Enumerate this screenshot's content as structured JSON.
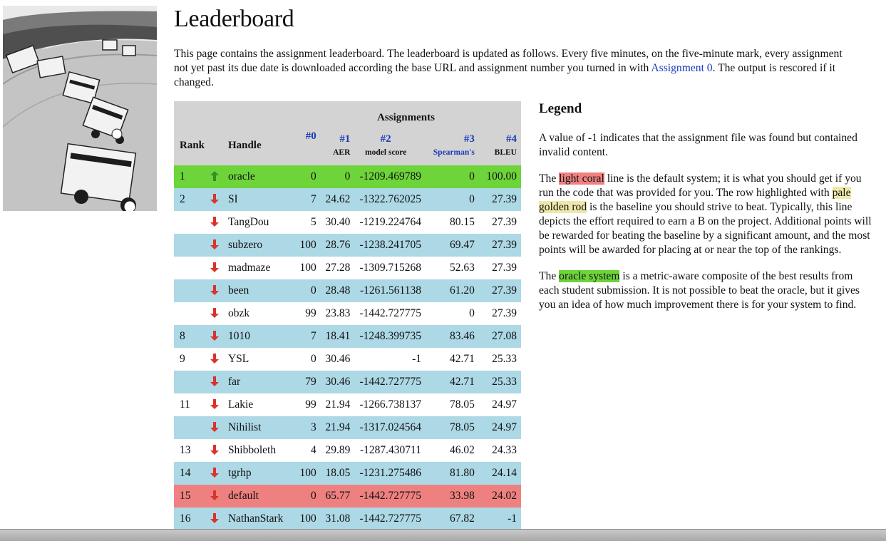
{
  "page": {
    "title": "Leaderboard",
    "intro_before_link": "This page contains the assignment leaderboard. The leaderboard is updated as follows. Every five minutes, on the five-minute mark, every assignment not yet past its due date is downloaded according the base URL and assignment number you turned in with ",
    "intro_link": "Assignment 0",
    "intro_after_link": ". The output is rescored if it changed."
  },
  "table": {
    "group_header": "Assignments",
    "rank_header": "Rank",
    "handle_header": "Handle",
    "assignments": [
      {
        "num": "#0",
        "sub": ""
      },
      {
        "num": "#1",
        "sub": "AER"
      },
      {
        "num": "#2",
        "sub": "model score"
      },
      {
        "num": "#3",
        "sub": "Spearman's"
      },
      {
        "num": "#4",
        "sub": "BLEU"
      }
    ],
    "rows": [
      {
        "rank": "1",
        "arrow": "up",
        "handle": "oracle",
        "a0": "0",
        "a1": "0",
        "a2": "-1209.469789",
        "a3": "0",
        "a4": "100.00",
        "style": "oracle"
      },
      {
        "rank": "2",
        "arrow": "down",
        "handle": "SI",
        "a0": "7",
        "a1": "24.62",
        "a2": "-1322.762025",
        "a3": "0",
        "a4": "27.39",
        "style": "even"
      },
      {
        "rank": "",
        "arrow": "down",
        "handle": "TangDou",
        "a0": "5",
        "a1": "30.40",
        "a2": "-1219.224764",
        "a3": "80.15",
        "a4": "27.39",
        "style": "odd"
      },
      {
        "rank": "",
        "arrow": "down",
        "handle": "subzero",
        "a0": "100",
        "a1": "28.76",
        "a2": "-1238.241705",
        "a3": "69.47",
        "a4": "27.39",
        "style": "even"
      },
      {
        "rank": "",
        "arrow": "down",
        "handle": "madmaze",
        "a0": "100",
        "a1": "27.28",
        "a2": "-1309.715268",
        "a3": "52.63",
        "a4": "27.39",
        "style": "odd"
      },
      {
        "rank": "",
        "arrow": "down",
        "handle": "been",
        "a0": "0",
        "a1": "28.48",
        "a2": "-1261.561138",
        "a3": "61.20",
        "a4": "27.39",
        "style": "even"
      },
      {
        "rank": "",
        "arrow": "down",
        "handle": "obzk",
        "a0": "99",
        "a1": "23.83",
        "a2": "-1442.727775",
        "a3": "0",
        "a4": "27.39",
        "style": "odd"
      },
      {
        "rank": "8",
        "arrow": "down",
        "handle": "1010",
        "a0": "7",
        "a1": "18.41",
        "a2": "-1248.399735",
        "a3": "83.46",
        "a4": "27.08",
        "style": "even"
      },
      {
        "rank": "9",
        "arrow": "down",
        "handle": "YSL",
        "a0": "0",
        "a1": "30.46",
        "a2": "-1",
        "a3": "42.71",
        "a4": "25.33",
        "style": "odd"
      },
      {
        "rank": "",
        "arrow": "down",
        "handle": "far",
        "a0": "79",
        "a1": "30.46",
        "a2": "-1442.727775",
        "a3": "42.71",
        "a4": "25.33",
        "style": "even"
      },
      {
        "rank": "11",
        "arrow": "down",
        "handle": "Lakie",
        "a0": "99",
        "a1": "21.94",
        "a2": "-1266.738137",
        "a3": "78.05",
        "a4": "24.97",
        "style": "odd"
      },
      {
        "rank": "",
        "arrow": "down",
        "handle": "Nihilist",
        "a0": "3",
        "a1": "21.94",
        "a2": "-1317.024564",
        "a3": "78.05",
        "a4": "24.97",
        "style": "even"
      },
      {
        "rank": "13",
        "arrow": "down",
        "handle": "Shibboleth",
        "a0": "4",
        "a1": "29.89",
        "a2": "-1287.430711",
        "a3": "46.02",
        "a4": "24.33",
        "style": "odd"
      },
      {
        "rank": "14",
        "arrow": "down",
        "handle": "tgrhp",
        "a0": "100",
        "a1": "18.05",
        "a2": "-1231.275486",
        "a3": "81.80",
        "a4": "24.14",
        "style": "even"
      },
      {
        "rank": "15",
        "arrow": "down",
        "handle": "default",
        "a0": "0",
        "a1": "65.77",
        "a2": "-1442.727775",
        "a3": "33.98",
        "a4": "24.02",
        "style": "baseline"
      },
      {
        "rank": "16",
        "arrow": "down",
        "handle": "NathanStark",
        "a0": "100",
        "a1": "31.08",
        "a2": "-1442.727775",
        "a3": "67.82",
        "a4": "-1",
        "style": "even"
      }
    ]
  },
  "legend": {
    "title": "Legend",
    "p1": "A value of -1 indicates that the assignment file was found but contained invalid content.",
    "p2_a": "The ",
    "p2_hl1": "light coral",
    "p2_b": " line is the default system; it is what you should get if you run the code that was provided for you. The row highlighted with ",
    "p2_hl2": "pale golden rod",
    "p2_c": " is the baseline you should strive to beat. Typically, this line depicts the effort required to earn a B on the project. Additional points will be rewarded for beating the baseline by a significant amount, and the most points will be awarded for placing at or near the top of the rankings.",
    "p3_a": "The ",
    "p3_hl": "oracle system",
    "p3_b": " is a metric-aware composite of the best results from each student submission. It is not possible to beat the oracle, but it gives you an idea of how much improvement there is for your system to find."
  },
  "colors": {
    "oracle_row": "#6dd43a",
    "baseline_row": "#ef8080",
    "alt_row": "#add8e6",
    "header_bg": "#d3d3d3",
    "link": "#1a3ab8",
    "arrow_up": "#3b8a24",
    "arrow_down": "#d9342b"
  },
  "icons": {
    "up": "arrow-up-icon",
    "down": "arrow-down-icon"
  }
}
